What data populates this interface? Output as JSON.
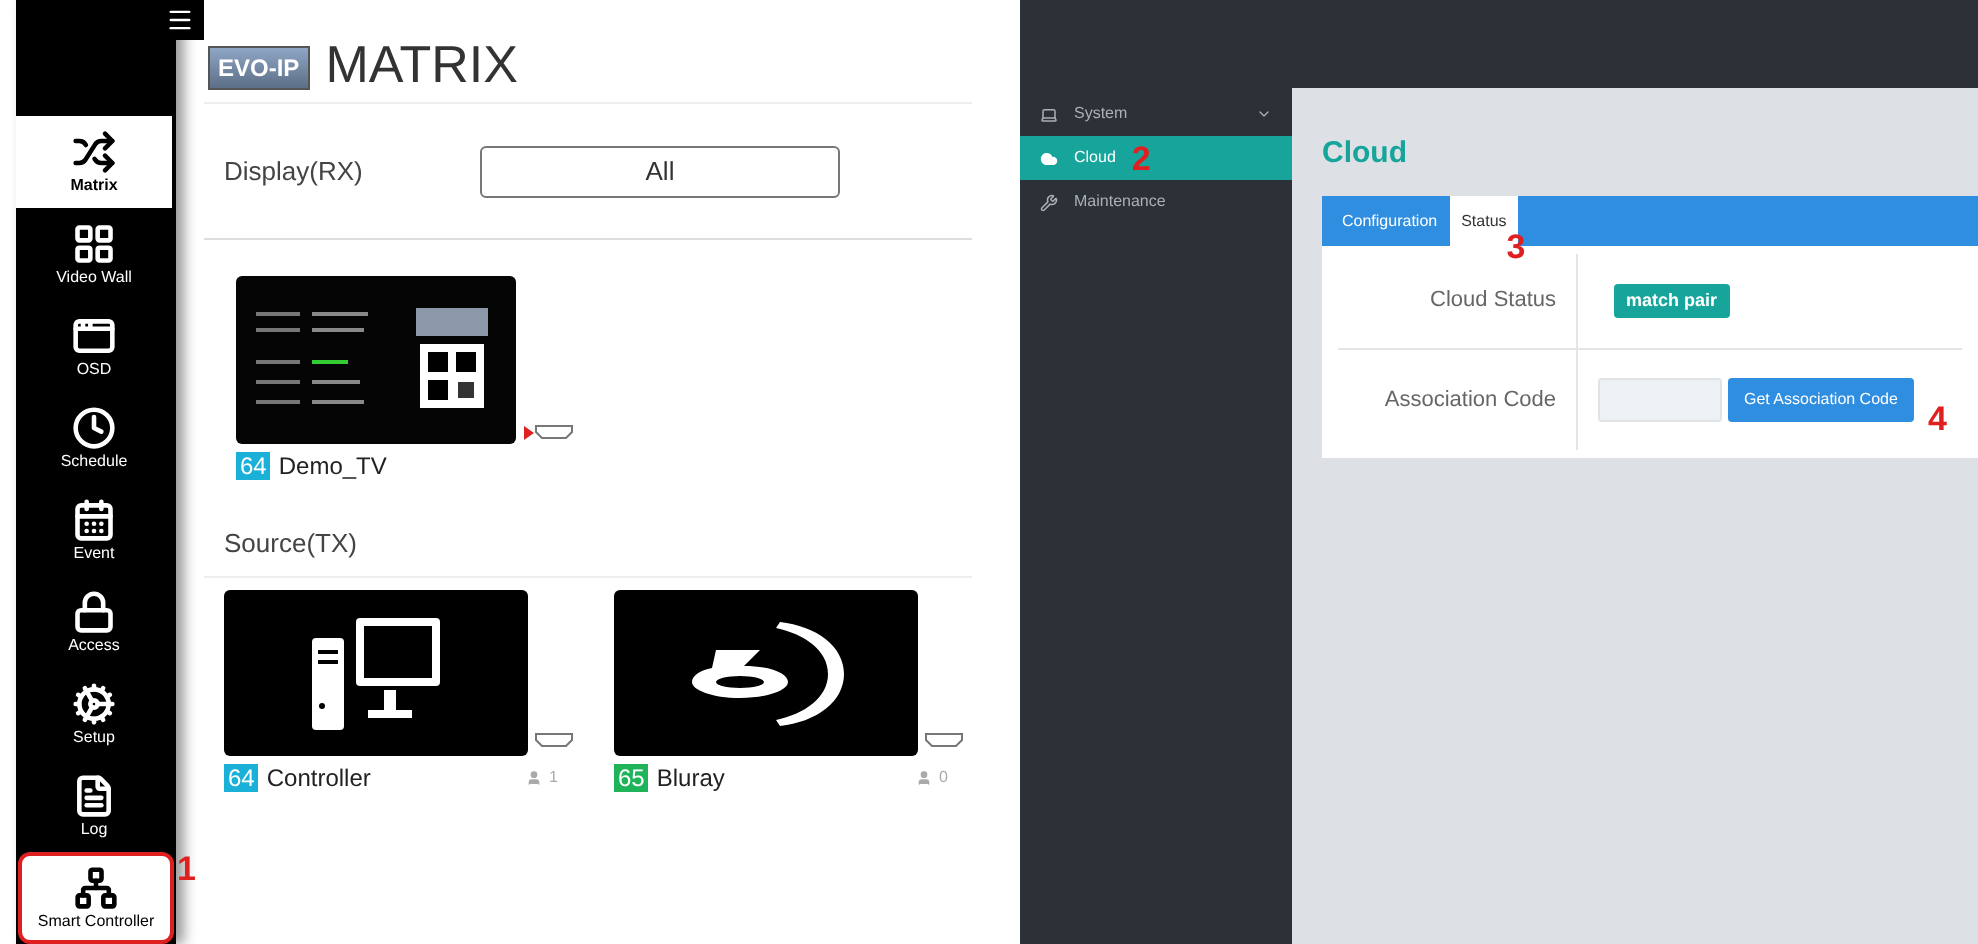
{
  "matrix_app": {
    "logo": "EVO-IP",
    "title": "MATRIX",
    "nav": [
      {
        "label": "Matrix",
        "selected": true,
        "highlighted": false
      },
      {
        "label": "Video Wall",
        "selected": false,
        "highlighted": false
      },
      {
        "label": "OSD",
        "selected": false,
        "highlighted": false
      },
      {
        "label": "Schedule",
        "selected": false,
        "highlighted": false
      },
      {
        "label": "Event",
        "selected": false,
        "highlighted": false
      },
      {
        "label": "Access",
        "selected": false,
        "highlighted": false
      },
      {
        "label": "Setup",
        "selected": false,
        "highlighted": false
      },
      {
        "label": "Log",
        "selected": false,
        "highlighted": false
      },
      {
        "label": "Smart Controller",
        "selected": false,
        "highlighted": true,
        "marker": "1"
      }
    ],
    "display_label": "Display(RX)",
    "display_filter": "All",
    "displays": [
      {
        "id": "64",
        "name": "Demo_TV",
        "color": "#1ab0d8"
      }
    ],
    "source_label": "Source(TX)",
    "sources": [
      {
        "id": "64",
        "name": "Controller",
        "color": "#1ab0d8",
        "users": "1"
      },
      {
        "id": "65",
        "name": "Bluray",
        "color": "#1fb45a",
        "users": "0"
      }
    ]
  },
  "cloud_app": {
    "nav": [
      {
        "label": "System",
        "selected": false,
        "dropdown": true
      },
      {
        "label": "Cloud",
        "selected": true,
        "dropdown": false,
        "marker": "2"
      },
      {
        "label": "Maintenance",
        "selected": false,
        "dropdown": false
      }
    ],
    "title": "Cloud",
    "tabs": [
      {
        "label": "Configuration",
        "selected": false
      },
      {
        "label": "Status",
        "selected": true,
        "marker": "3"
      }
    ],
    "cloud_status_label": "Cloud Status",
    "cloud_status": "match pair",
    "association_code_label": "Association Code",
    "association_button": "Get Association Code",
    "button_marker": "4"
  }
}
